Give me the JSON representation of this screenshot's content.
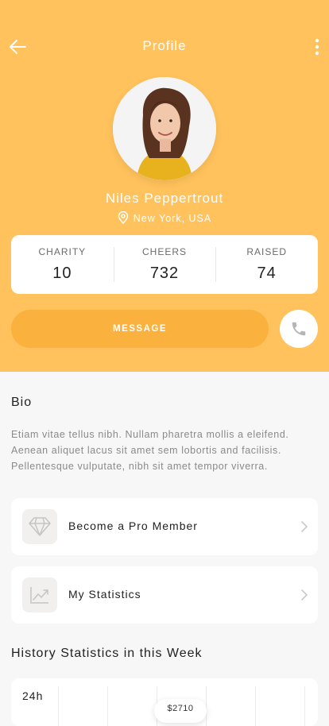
{
  "header": {
    "title": "Profile"
  },
  "profile": {
    "name": "Niles Peppertrout",
    "location": "New York, USA"
  },
  "stats": [
    {
      "label": "CHARITY",
      "value": "10"
    },
    {
      "label": "CHEERS",
      "value": "732"
    },
    {
      "label": "RAISED",
      "value": "74"
    }
  ],
  "actions": {
    "message_label": "MESSAGE"
  },
  "bio": {
    "title": "Bio",
    "text": "Etiam vitae tellus nibh. Nullam pharetra mollis a eleifend. Aenean aliquet lacus sit amet sem lobortis and facilisis. Pellentesque vulputate, nibh sit amet tempor viverra."
  },
  "menu": [
    {
      "label": "Become a Pro Member",
      "icon": "diamond-icon"
    },
    {
      "label": "My Statistics",
      "icon": "chart-icon"
    }
  ],
  "history": {
    "title": "History Statistics in this Week",
    "period": "24h",
    "tooltip": "$2710"
  },
  "colors": {
    "accent": "#ffc25c",
    "button": "#fbb13d"
  }
}
